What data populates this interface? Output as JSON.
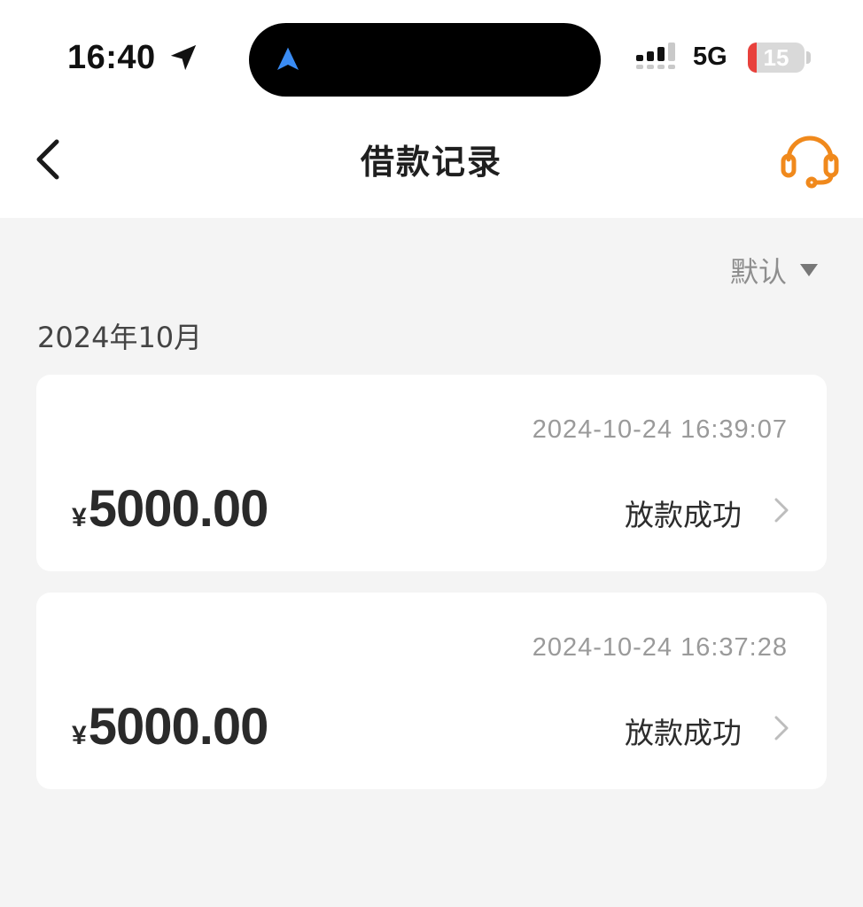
{
  "status_bar": {
    "time": "16:40",
    "network": "5G",
    "battery_level": "15",
    "battery_fraction": 0.15,
    "icons": [
      "location-arrow-icon",
      "navigation-arrow-icon",
      "signal-icon",
      "battery-icon"
    ]
  },
  "header": {
    "title": "借款记录",
    "back_icon": "chevron-left-icon",
    "support_icon": "headset-icon"
  },
  "colors": {
    "accent": "#f0891c",
    "nav_arrow": "#3a8cf4",
    "battery_low": "#e8413c",
    "background": "#f4f4f4",
    "card": "#ffffff"
  },
  "filter": {
    "sort_label": "默认",
    "sort_icon": "caret-down-icon"
  },
  "records": {
    "month": "2024年10月",
    "items": [
      {
        "timestamp": "2024-10-24 16:39:07",
        "currency": "¥",
        "amount": "5000.00",
        "status": "放款成功"
      },
      {
        "timestamp": "2024-10-24 16:37:28",
        "currency": "¥",
        "amount": "5000.00",
        "status": "放款成功"
      }
    ]
  }
}
